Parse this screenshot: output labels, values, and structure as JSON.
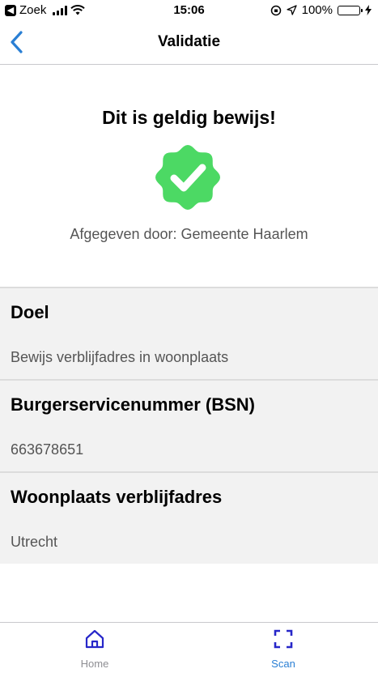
{
  "status_bar": {
    "carrier": "Zoek",
    "time": "15:06",
    "battery": "100%",
    "battery_level": 1.0
  },
  "navbar": {
    "title": "Validatie",
    "back_icon": "chevron-left-icon"
  },
  "result": {
    "heading": "Dit is geldig bewijs!",
    "badge_icon": "verified-check-badge-icon",
    "issuer_text": "Afgegeven door: Gemeente Haarlem"
  },
  "details": [
    {
      "label": "Doel",
      "value": "Bewijs verblijfadres in woonplaats"
    },
    {
      "label": "Burgerservicenummer (BSN)",
      "value": "663678651"
    },
    {
      "label": "Woonplaats verblijfadres",
      "value": "Utrecht"
    }
  ],
  "tabs": [
    {
      "label": "Home",
      "icon": "home-icon",
      "active": false
    },
    {
      "label": "Scan",
      "icon": "scan-icon",
      "active": true
    }
  ],
  "colors": {
    "accent": "#2a7fd4",
    "badge": "#4cd964",
    "tab_active": "#2727c9",
    "tab_inactive": "#8e8e93"
  }
}
